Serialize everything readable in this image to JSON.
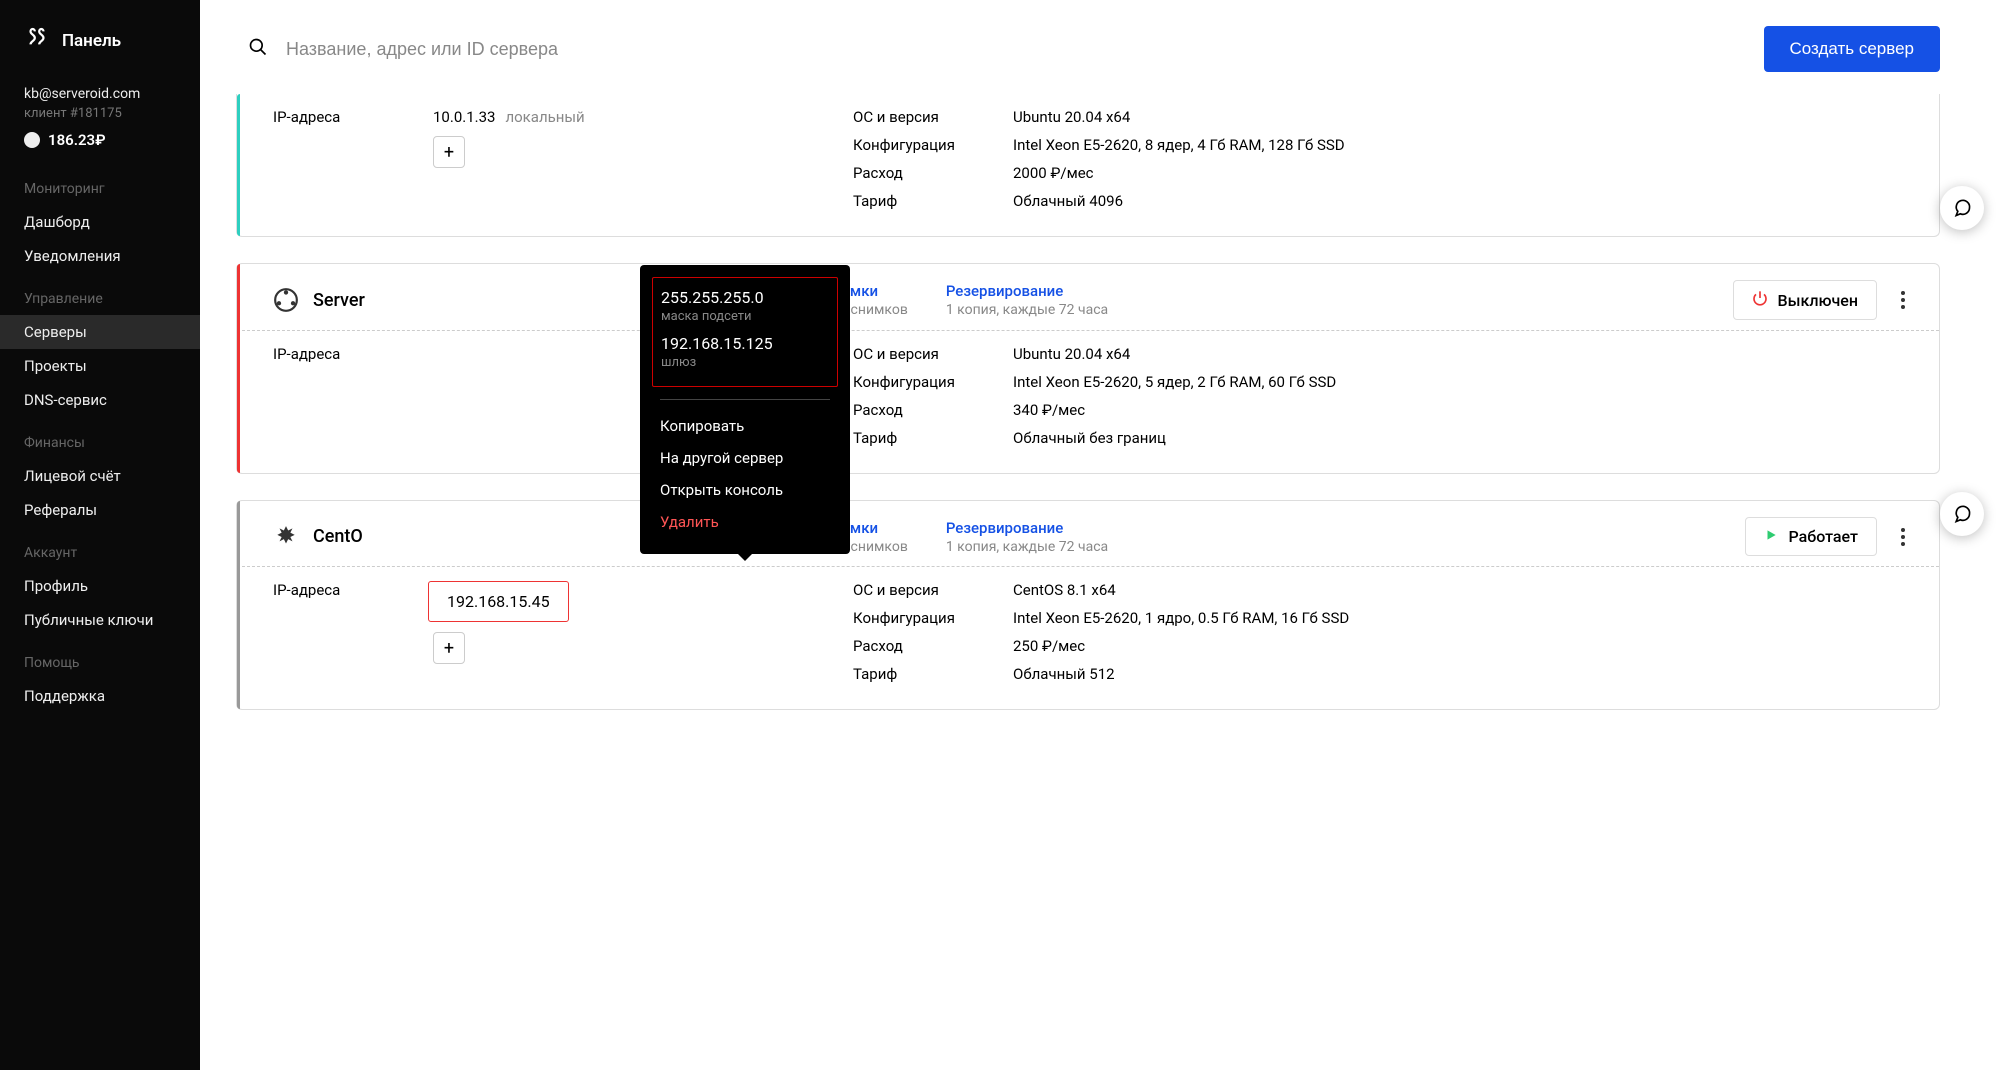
{
  "brand": {
    "title": "Панель"
  },
  "account": {
    "email": "kb@serveroid.com",
    "client": "клиент #181175",
    "balance": "186.23₽"
  },
  "search": {
    "placeholder": "Название, адрес или ID сервера"
  },
  "create_button": "Создать сервер",
  "nav": {
    "monitoring": {
      "heading": "Мониторинг",
      "items": [
        "Дашборд",
        "Уведомления"
      ]
    },
    "management": {
      "heading": "Управление",
      "items": [
        "Серверы",
        "Проекты",
        "DNS-сервис"
      ]
    },
    "finance": {
      "heading": "Финансы",
      "items": [
        "Лицевой счёт",
        "Рефералы"
      ]
    },
    "account_sec": {
      "heading": "Аккаунт",
      "items": [
        "Профиль",
        "Публичные ключи"
      ]
    },
    "help": {
      "heading": "Помощь",
      "items": [
        "Поддержка"
      ]
    }
  },
  "labels": {
    "ip": "IP-адреса",
    "os": "ОС и версия",
    "config": "Конфигурация",
    "cost": "Расход",
    "tariff": "Тариф",
    "snapshots": "Снимки",
    "backup": "Резервирование"
  },
  "status": {
    "off": "Выключен",
    "on": "Работает"
  },
  "servers": [
    {
      "ip": "10.0.1.33",
      "ip_type": "локальный",
      "os": "Ubuntu 20.04 x64",
      "config": "Intel Xeon E5-2620, 8 ядер, 4 Гб RAM, 128 Гб SSD",
      "cost": "2000 ₽/мес",
      "tariff": "Облачный 4096"
    },
    {
      "name": "Server",
      "snapshots_sub": "Нет снимков",
      "backup_sub": "1 копия, каждые 72 часа",
      "status": "off",
      "os": "Ubuntu 20.04 x64",
      "config": "Intel Xeon E5-2620, 5 ядер, 2 Гб RAM, 60 Гб SSD",
      "cost": "340 ₽/мес",
      "tariff": "Облачный без границ"
    },
    {
      "name": "CentO",
      "snapshots_sub": "Нет снимков",
      "backup_sub": "1 копия, каждые 72 часа",
      "status": "on",
      "ip": "192.168.15.45",
      "os": "CentOS 8.1 x64",
      "config": "Intel Xeon E5-2620, 1 ядро, 0.5 Гб RAM, 16 Гб SSD",
      "cost": "250 ₽/мес",
      "tariff": "Облачный 512"
    }
  ],
  "popover": {
    "mask": "255.255.255.0",
    "mask_label": "маска подсети",
    "gateway": "192.168.15.125",
    "gateway_label": "шлюз",
    "copy": "Копировать",
    "move": "На другой сервер",
    "console": "Открыть консоль",
    "delete": "Удалить"
  }
}
